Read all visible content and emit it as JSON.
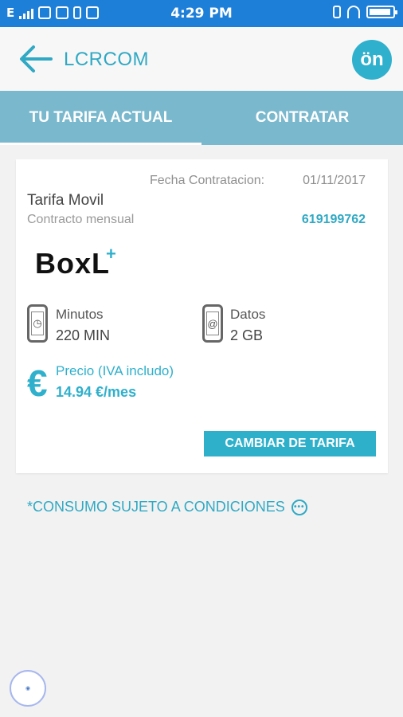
{
  "status_bar": {
    "network": "E",
    "time": "4:29 PM",
    "battery_icon": "battery-icon"
  },
  "app_bar": {
    "title": "LCRCOM",
    "logo_text": "ön"
  },
  "tabs": [
    {
      "label": "TU TARIFA ACTUAL",
      "active": true
    },
    {
      "label": "CONTRATAR",
      "active": false
    }
  ],
  "card": {
    "fecha_label": "Fecha Contratacion:",
    "fecha_value": "01/11/2017",
    "tarifa_title": "Tarifa Movil",
    "contract_label": "Contracto mensual",
    "phone_number": "619199762",
    "plan_logo": "BoxL",
    "plan_plus": "+",
    "minutes": {
      "label": "Minutos",
      "value": "220 MIN",
      "icon": "clock-icon"
    },
    "data": {
      "label": "Datos",
      "value": "2 GB",
      "icon": "at-icon"
    },
    "price_symbol": "€",
    "price_label": "Precio (IVA includo)",
    "price_value": "14.94 €/mes",
    "change_button": "CAMBIAR DE TARIFA"
  },
  "conditions": {
    "text": "*CONSUMO SUJETO A CONDICIONES",
    "icon": "more-icon"
  },
  "colors": {
    "status_bar": "#1e7fd8",
    "accent": "#2fb0cc",
    "tabs_bg": "#7ab8ce"
  }
}
